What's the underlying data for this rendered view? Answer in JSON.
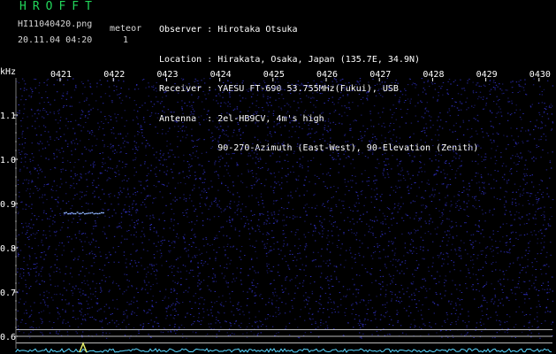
{
  "header": {
    "app_title": "HROFFT",
    "file_name": "HI11040420.png",
    "date_time": "20.11.04 04:20",
    "meteor_label": "meteor",
    "meteor_count": "1"
  },
  "station": {
    "lines": [
      "Observer : Hirotaka Otsuka",
      "Location : Hirakata, Osaka, Japan (135.7E, 34.9N)",
      "Receiver : YAESU FT-690 53.755MHz(Fukui), USB",
      "Antenna  : 2el-HB9CV, 4m's high",
      "           90-270-Azimuth (East-West), 90-Elevation (Zenith)"
    ]
  },
  "chart_data": {
    "type": "heatmap",
    "title": "",
    "ylabel": "kHz",
    "xlabel": "",
    "x_ticks": [
      "0421",
      "0422",
      "0423",
      "0424",
      "0425",
      "0426",
      "0427",
      "0428",
      "0429",
      "0430"
    ],
    "y_ticks": [
      "1.1",
      "1.0",
      "0.9",
      "0.8",
      "0.7",
      "0.6"
    ],
    "y_tick_values": [
      1.1,
      1.0,
      0.9,
      0.8,
      0.7,
      0.6
    ],
    "ylim": [
      0.58,
      1.2
    ],
    "reference_lines_khz": [
      0.615,
      0.6,
      0.585
    ],
    "colors": {
      "background": "#000000",
      "noise": "#2a2aa8",
      "echo": "#8fb4ff",
      "tick": "#ffffff",
      "reference_line": "#b8b8b8",
      "noise_trace": "#5ad6ff"
    },
    "meteor_echoes": [
      {
        "time_start": "04:21.2",
        "time_end": "04:22.0",
        "khz": 0.88
      }
    ]
  }
}
